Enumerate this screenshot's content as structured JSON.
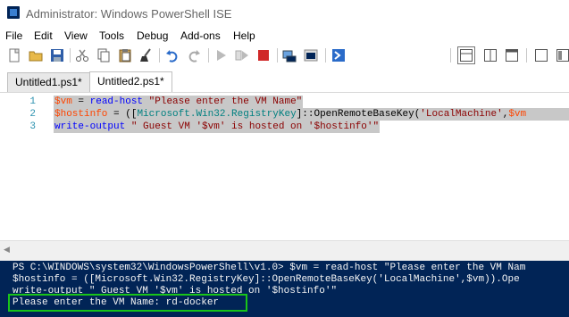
{
  "window": {
    "title": "Administrator: Windows PowerShell ISE"
  },
  "menu": [
    "File",
    "Edit",
    "View",
    "Tools",
    "Debug",
    "Add-ons",
    "Help"
  ],
  "toolbar": {
    "buttons": [
      "new-script",
      "open",
      "save",
      "cut",
      "copy",
      "paste",
      "clear",
      "undo",
      "redo",
      "run-script",
      "run-selection",
      "stop",
      "new-remote-tab",
      "start-powershell",
      "show-script-pane-top",
      "show-script-pane-right",
      "show-script-pane-maximized"
    ]
  },
  "tabs": [
    {
      "label": "Untitled1.ps1*"
    },
    {
      "label": "Untitled2.ps1*"
    }
  ],
  "editor": {
    "line_numbers": [
      "1",
      "2",
      "3"
    ],
    "lines": [
      {
        "p1": "$vm",
        "p2": " = ",
        "p3": "read-host",
        "p4": " ",
        "p5": "\"Please enter the VM Name\""
      },
      {
        "p1": "$hostinfo",
        "p2": " = ([",
        "p3": "Microsoft.Win32.RegistryKey",
        "p4": "]::OpenRemoteBaseKey(",
        "p5": "'LocalMachine'",
        "p6": ",",
        "p7": "$vm"
      },
      {
        "p1": "write-output",
        "p2": " ",
        "p3": "\" Guest VM '$vm' is hosted on '$hostinfo'\""
      }
    ]
  },
  "console": {
    "lines": [
      "PS C:\\WINDOWS\\system32\\WindowsPowerShell\\v1.0> $vm = read-host \"Please enter the VM Nam",
      "$hostinfo = ([Microsoft.Win32.RegistryKey]::OpenRemoteBaseKey('LocalMachine',$vm)).Ope",
      "write-output \" Guest VM '$vm' is hosted on '$hostinfo'\"",
      "Please enter the VM Name: rd-docker"
    ]
  }
}
